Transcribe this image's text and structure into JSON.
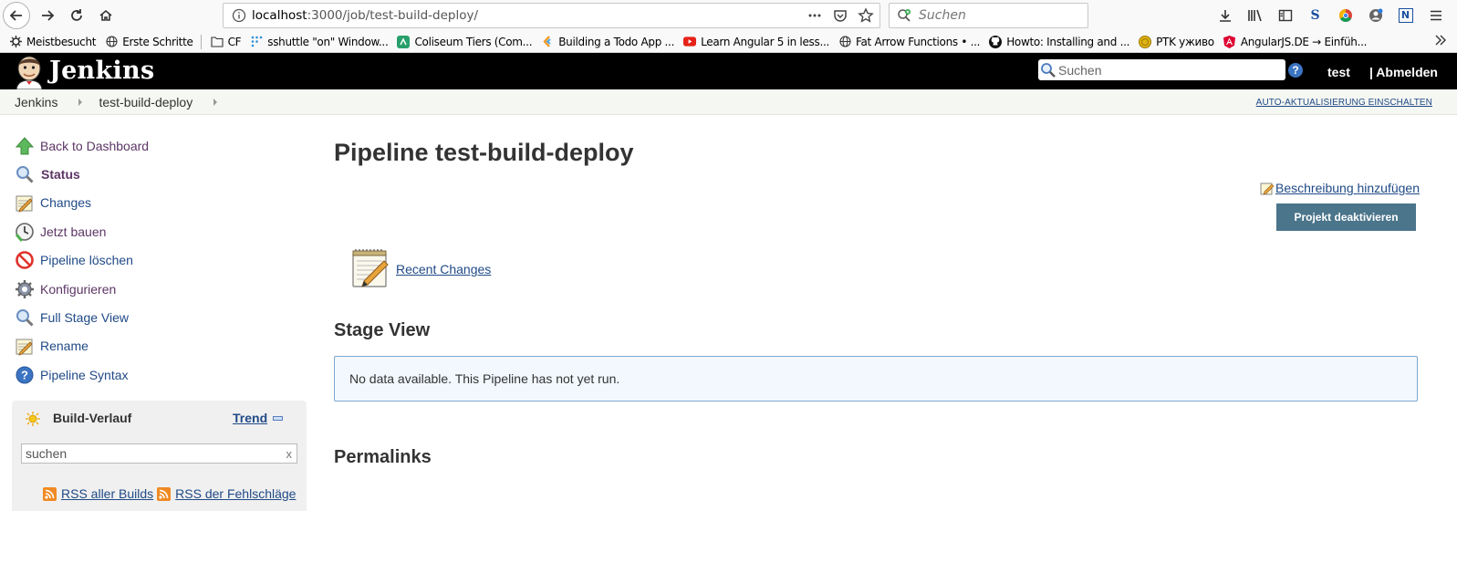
{
  "browser": {
    "url_host": "localhost",
    "url_rest": ":3000/job/test-build-deploy/",
    "search_placeholder": "Suchen",
    "bookmarks": [
      {
        "label": "Meistbesucht",
        "icon": "gear-icon"
      },
      {
        "label": "Erste Schritte",
        "icon": "globe-icon"
      },
      {
        "label": "CF",
        "icon": "folder-icon"
      },
      {
        "label": "sshuttle \"on\" Window...",
        "icon": "dots-icon"
      },
      {
        "label": "Coliseum Tiers (Com...",
        "icon": "app-icon"
      },
      {
        "label": "Building a Todo App ...",
        "icon": "arrow-icon"
      },
      {
        "label": "Learn Angular 5 in less...",
        "icon": "youtube-icon"
      },
      {
        "label": "Fat Arrow Functions • ...",
        "icon": "globe-icon"
      },
      {
        "label": "Howto: Installing and ...",
        "icon": "github-icon"
      },
      {
        "label": "PTK уживо",
        "icon": "coin-icon"
      },
      {
        "label": "AngularJS.DE → Einfüh...",
        "icon": "angular-icon"
      }
    ]
  },
  "header": {
    "title": "Jenkins",
    "search_placeholder": "Suchen",
    "help": "?",
    "user": "test",
    "logout": "| Abmelden"
  },
  "breadcrumb": {
    "items": [
      "Jenkins",
      "test-build-deploy"
    ],
    "autorefresh": "AUTO-AKTUALISIERUNG EINSCHALTEN"
  },
  "sidebar": {
    "tasks": [
      {
        "label": "Back to Dashboard",
        "icon": "up-arrow-icon"
      },
      {
        "label": "Status",
        "icon": "magnifier-icon"
      },
      {
        "label": "Changes",
        "icon": "notepad-icon"
      },
      {
        "label": "Jetzt bauen",
        "icon": "clock-icon"
      },
      {
        "label": "Pipeline löschen",
        "icon": "no-entry-icon"
      },
      {
        "label": "Konfigurieren",
        "icon": "gear-icon"
      },
      {
        "label": "Full Stage View",
        "icon": "magnifier-icon"
      },
      {
        "label": "Rename",
        "icon": "notepad-icon"
      },
      {
        "label": "Pipeline Syntax",
        "icon": "help-icon"
      }
    ],
    "build_history": {
      "title": "Build-Verlauf",
      "trend": "Trend",
      "search_placeholder": "suchen",
      "clear": "x",
      "rss_all": "RSS aller Builds",
      "rss_failures": "RSS der Fehlschläge"
    }
  },
  "main": {
    "title": "Pipeline test-build-deploy",
    "add_description": "Beschreibung hinzufügen",
    "disable_button": "Projekt deaktivieren",
    "recent_changes": "Recent Changes",
    "stage_view_title": "Stage View",
    "no_data": "No data available. This Pipeline has not yet run.",
    "permalinks_title": "Permalinks"
  },
  "colors": {
    "link": "#204a87",
    "visited_link": "#5c3566",
    "header_bg": "#000000",
    "button_bg": "#4b758b",
    "info_border": "#7fa7d1"
  }
}
